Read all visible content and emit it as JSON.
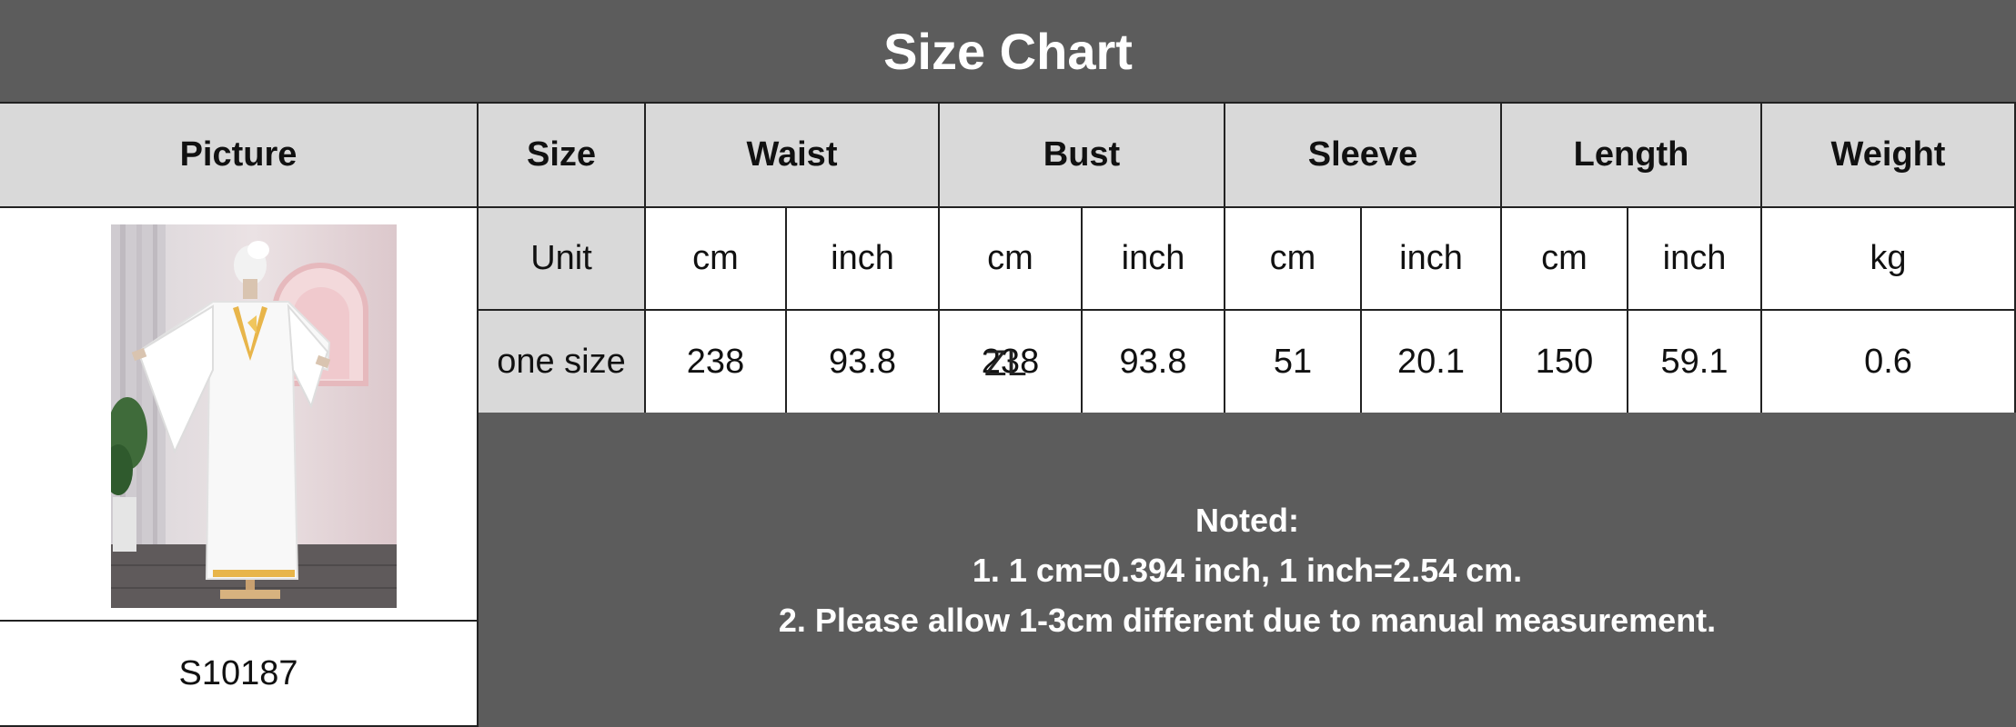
{
  "title": "Size Chart",
  "headers": {
    "picture": "Picture",
    "size": "Size",
    "waist": "Waist",
    "bust": "Bust",
    "sleeve": "Sleeve",
    "length": "Length",
    "weight": "Weight"
  },
  "units_row": {
    "label": "Unit",
    "waist_cm": "cm",
    "waist_inch": "inch",
    "bust_cm": "cm",
    "bust_inch": "inch",
    "sleeve_cm": "cm",
    "sleeve_inch": "inch",
    "length_cm": "cm",
    "length_inch": "inch",
    "weight": "kg"
  },
  "size_row": {
    "label": "one size",
    "waist_cm": "238",
    "waist_inch": "93.8",
    "bust_cm": "238",
    "bust_inch": "93.8",
    "sleeve_cm": "51",
    "sleeve_inch": "20.1",
    "length_cm": "150",
    "length_inch": "59.1",
    "weight": "0.6"
  },
  "product_code": "S10187",
  "notes": {
    "heading": "Noted:",
    "line1": "1. 1 cm=0.394 inch, 1 inch=2.54 cm.",
    "line2": "2. Please allow 1-3cm different due to manual measurement."
  },
  "watermark": "ZL",
  "colors": {
    "header_dark": "#5c5c5c",
    "header_light": "#d9d9d9",
    "accent_gold": "#e8b54a"
  }
}
